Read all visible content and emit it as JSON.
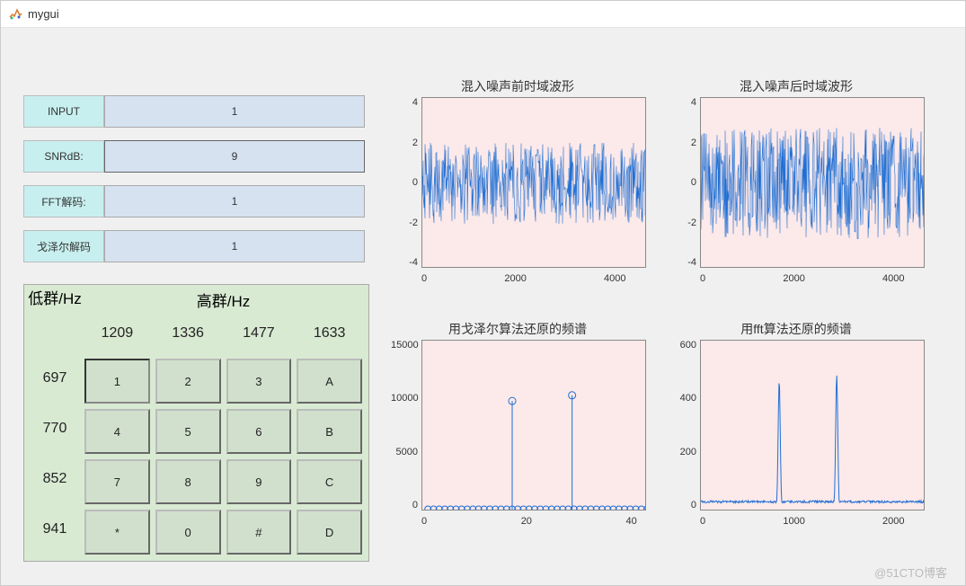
{
  "window": {
    "title": "mygui"
  },
  "inputs": {
    "input_label": "INPUT",
    "input_value": "1",
    "snr_label": "SNRdB:",
    "snr_value": "9",
    "fft_label": "FFT解码:",
    "fft_value": "1",
    "goertzel_label": "戈泽尔解码",
    "goertzel_value": "1"
  },
  "grid": {
    "low_header": "低群/Hz",
    "high_header": "高群/Hz",
    "high_freqs": [
      "1209",
      "1336",
      "1477",
      "1633"
    ],
    "low_freqs": [
      "697",
      "770",
      "852",
      "941"
    ],
    "buttons": [
      [
        "1",
        "2",
        "3",
        "A"
      ],
      [
        "4",
        "5",
        "6",
        "B"
      ],
      [
        "7",
        "8",
        "9",
        "C"
      ],
      [
        "*",
        "0",
        "#",
        "D"
      ]
    ],
    "active": [
      0,
      0
    ]
  },
  "chart_data": [
    {
      "type": "line",
      "title": "混入噪声前时域波形",
      "xlim": [
        0,
        4000
      ],
      "ylim": [
        -4,
        4
      ],
      "xticks": [
        "0",
        "2000",
        "4000"
      ],
      "yticks": [
        "4",
        "2",
        "0",
        "-2",
        "-4"
      ],
      "style": "noise",
      "amp": 1.9,
      "center": 0
    },
    {
      "type": "line",
      "title": "混入噪声后时域波形",
      "xlim": [
        0,
        4000
      ],
      "ylim": [
        -4,
        4
      ],
      "xticks": [
        "0",
        "2000",
        "4000"
      ],
      "yticks": [
        "4",
        "2",
        "0",
        "-2",
        "-4"
      ],
      "style": "noise",
      "amp": 2.6,
      "center": 0
    },
    {
      "type": "scatter",
      "title": "用戈泽尔算法还原的频谱",
      "xlim": [
        0,
        45
      ],
      "ylim": [
        0,
        15000
      ],
      "xticks": [
        "0",
        "20",
        "40"
      ],
      "yticks": [
        "15000",
        "10000",
        "5000",
        "0"
      ],
      "stems": [
        {
          "x": 18,
          "y": 9700
        },
        {
          "x": 30,
          "y": 10200
        }
      ],
      "baseline_points": 40
    },
    {
      "type": "line",
      "title": "用fft算法还原的频谱",
      "xlim": [
        0,
        2000
      ],
      "ylim": [
        0,
        600
      ],
      "xticks": [
        "0",
        "1000",
        "2000"
      ],
      "yticks": [
        "600",
        "400",
        "200",
        "0"
      ],
      "peaks": [
        {
          "x": 697,
          "y": 460
        },
        {
          "x": 1209,
          "y": 480
        }
      ],
      "baseline": 30
    }
  ],
  "watermark": "@51CTO博客"
}
